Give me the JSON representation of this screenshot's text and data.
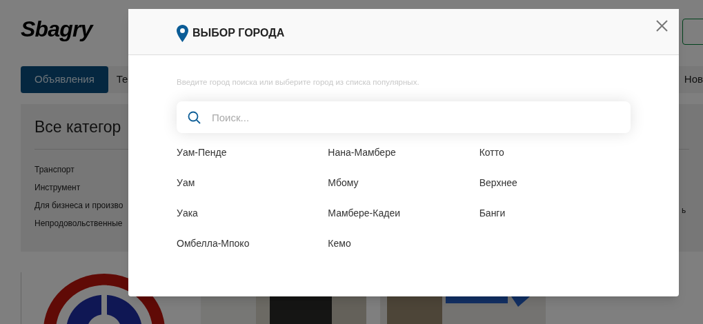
{
  "page": {
    "logo": "Sbagry",
    "tabs": [
      {
        "label": "Объявления",
        "selected": true
      },
      {
        "label": "Те",
        "selected": false
      }
    ],
    "right_tab": "Нов",
    "categories": {
      "title": "Все категор",
      "items": [
        "Транспорт",
        "Инструмент",
        "Для бизнеса и произво",
        "Непродовольственные"
      ]
    },
    "right_fragment": "ь"
  },
  "modal": {
    "title": "ВЫБОР ГОРОДА",
    "hint": "Введите город поиска или выберите город из списка популярных.",
    "search": {
      "placeholder": "Поиск..."
    },
    "city_columns": [
      [
        "Уам-Пенде",
        "Уам",
        "Уака",
        "Омбелла-Мпоко"
      ],
      [
        "Нана-Мамбере",
        "Мбому",
        "Мамбере-Кадеи",
        "Кемо"
      ],
      [
        "Котто",
        "Верхнее",
        "Банги"
      ]
    ]
  }
}
